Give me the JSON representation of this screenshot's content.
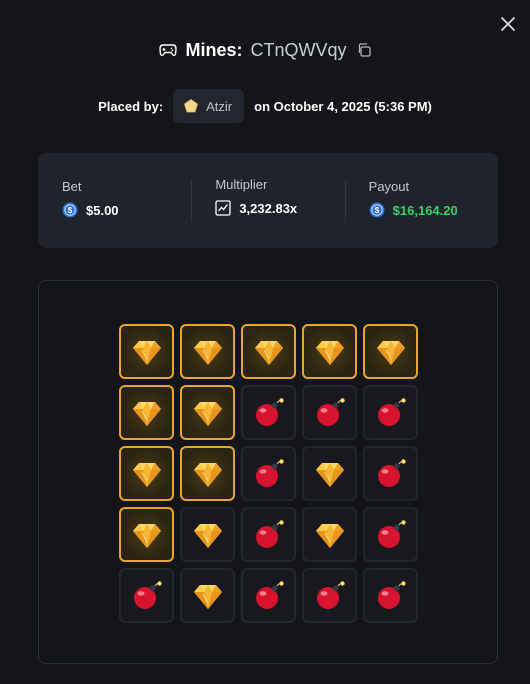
{
  "modal": {
    "close_icon": "close-icon"
  },
  "header": {
    "game_icon": "gamepad-icon",
    "game_name": "Mines:",
    "game_id": "CTnQWVqy",
    "copy_icon": "copy-icon"
  },
  "placed": {
    "label": "Placed by:",
    "user_badge_icon": "pentagon-badge-icon",
    "username": "Atzir",
    "date_text": "on October 4, 2025 (5:36 PM)"
  },
  "stats": {
    "bet_label": "Bet",
    "bet_value": "$5.00",
    "bet_icon": "coin-icon",
    "multiplier_label": "Multiplier",
    "multiplier_value": "3,232.83x",
    "multiplier_icon": "chart-icon",
    "payout_label": "Payout",
    "payout_value": "$16,164.20",
    "payout_icon": "coin-icon",
    "payout_color": "#3ad06c"
  },
  "board": {
    "accent_color": "#e7a52b",
    "rows": [
      [
        {
          "type": "gem",
          "revealed": true
        },
        {
          "type": "gem",
          "revealed": true
        },
        {
          "type": "gem",
          "revealed": true
        },
        {
          "type": "gem",
          "revealed": true
        },
        {
          "type": "gem",
          "revealed": true
        }
      ],
      [
        {
          "type": "gem",
          "revealed": true
        },
        {
          "type": "gem",
          "revealed": true
        },
        {
          "type": "bomb",
          "revealed": false
        },
        {
          "type": "bomb",
          "revealed": false
        },
        {
          "type": "bomb",
          "revealed": false
        }
      ],
      [
        {
          "type": "gem",
          "revealed": true
        },
        {
          "type": "gem",
          "revealed": true
        },
        {
          "type": "bomb",
          "revealed": false
        },
        {
          "type": "gem",
          "revealed": false
        },
        {
          "type": "bomb",
          "revealed": false
        }
      ],
      [
        {
          "type": "gem",
          "revealed": true
        },
        {
          "type": "gem",
          "revealed": false
        },
        {
          "type": "bomb",
          "revealed": false
        },
        {
          "type": "gem",
          "revealed": false
        },
        {
          "type": "bomb",
          "revealed": false
        }
      ],
      [
        {
          "type": "bomb",
          "revealed": false
        },
        {
          "type": "gem",
          "revealed": false
        },
        {
          "type": "bomb",
          "revealed": false
        },
        {
          "type": "bomb",
          "revealed": false
        },
        {
          "type": "bomb",
          "revealed": false
        }
      ]
    ]
  }
}
